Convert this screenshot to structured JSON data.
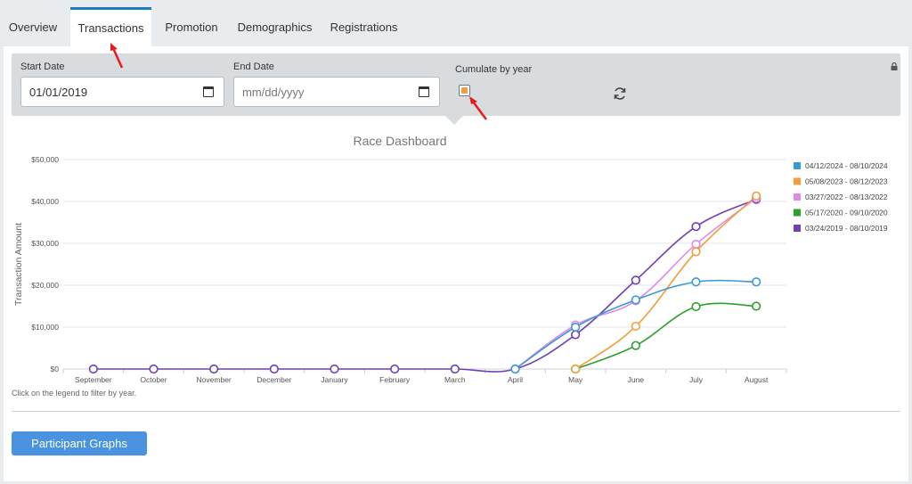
{
  "tabs": [
    {
      "label": "Overview",
      "active": false
    },
    {
      "label": "Transactions",
      "active": true
    },
    {
      "label": "Promotion",
      "active": false
    },
    {
      "label": "Demographics",
      "active": false
    },
    {
      "label": "Registrations",
      "active": false
    }
  ],
  "filters": {
    "start_label": "Start Date",
    "start_value": "01/01/2019",
    "end_label": "End Date",
    "end_placeholder": "mm/dd/yyyy",
    "cumulate_label": "Cumulate by year",
    "cumulate_checked": true
  },
  "chart_data": {
    "type": "line",
    "title": "Race Dashboard",
    "ylabel": "Transaction Amount",
    "xlabel": "",
    "categories": [
      "September",
      "October",
      "November",
      "December",
      "January",
      "February",
      "March",
      "April",
      "May",
      "June",
      "July",
      "August"
    ],
    "yticks": [
      "$0",
      "$10,000",
      "$20,000",
      "$30,000",
      "$40,000",
      "$50,000"
    ],
    "ylim": [
      0,
      50000
    ],
    "grid": true,
    "legend_position": "right",
    "series": [
      {
        "name": "04/12/2024 - 08/10/2024",
        "color": "#3a9ad9",
        "start": 7,
        "values": [
          0,
          0,
          0,
          0,
          0,
          0,
          0,
          0,
          10000,
          16500,
          20800,
          20800
        ]
      },
      {
        "name": "05/08/2023 - 08/12/2023",
        "color": "#f39c3a",
        "start": 8,
        "values": [
          0,
          0,
          0,
          0,
          0,
          0,
          0,
          0,
          0,
          10200,
          28000,
          41300
        ]
      },
      {
        "name": "03/27/2022 - 08/13/2022",
        "color": "#e08ae8",
        "start": 7,
        "values": [
          0,
          0,
          0,
          0,
          0,
          0,
          0,
          0,
          10500,
          16300,
          29800,
          40800
        ]
      },
      {
        "name": "05/17/2020 - 09/10/2020",
        "color": "#2ca02c",
        "start": 8,
        "values": [
          0,
          0,
          0,
          0,
          0,
          0,
          0,
          0,
          0,
          5600,
          14900,
          15000
        ]
      },
      {
        "name": "03/24/2019 - 08/10/2019",
        "color": "#6f3fb5",
        "start": 0,
        "values": [
          0,
          0,
          0,
          0,
          0,
          0,
          0,
          0,
          8200,
          21200,
          34000,
          40500
        ]
      }
    ]
  },
  "hint": "Click on the legend to filter by year.",
  "button_label": "Participant Graphs",
  "icons": {
    "refresh": "refresh-icon",
    "lock": "lock-icon",
    "calendar": "calendar-icon"
  }
}
